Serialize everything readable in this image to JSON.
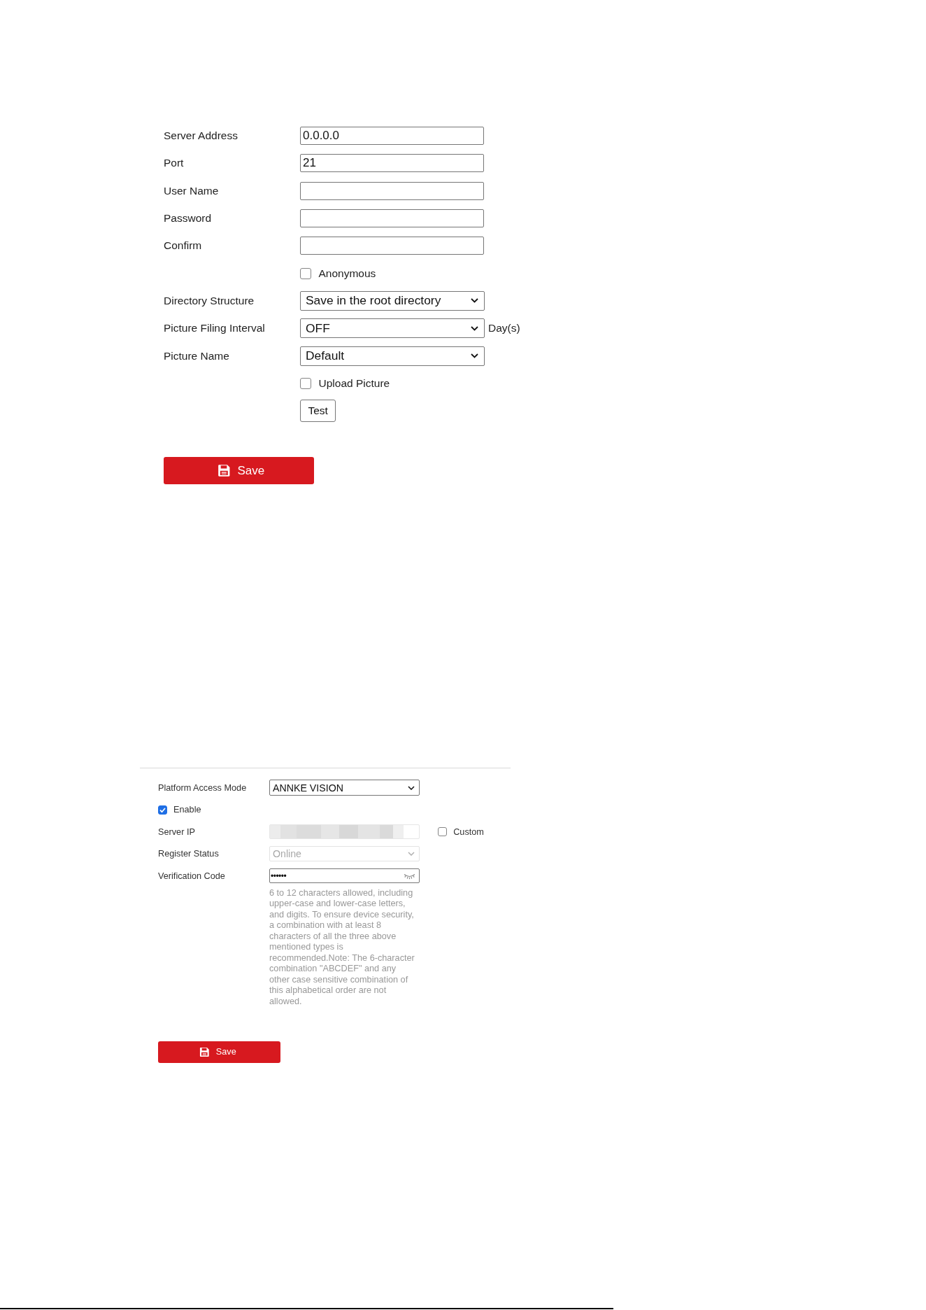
{
  "ftp_form": {
    "fields": [
      {
        "kind": "text",
        "label": "Server Address",
        "value": "0.0.0.0"
      },
      {
        "kind": "text",
        "label": "Port",
        "value": "21"
      },
      {
        "kind": "text",
        "label": "User Name"
      },
      {
        "kind": "text",
        "label": "Password"
      },
      {
        "kind": "text",
        "label": "Confirm"
      },
      {
        "kind": "checkbox",
        "label": "Anonymous",
        "checked": false
      },
      {
        "kind": "select",
        "label": "Directory Structure",
        "value": "Save in the root directory"
      },
      {
        "kind": "select",
        "label": "Picture Filing Interval",
        "value": "OFF",
        "unit": "Day(s)"
      },
      {
        "kind": "select",
        "label": "Picture Name",
        "value": "Default"
      },
      {
        "kind": "checkbox",
        "label": "Upload Picture",
        "checked": false
      },
      {
        "kind": "button",
        "label": "Test"
      }
    ],
    "save_button": "Save"
  },
  "platform_form": {
    "fields": [
      {
        "kind": "select",
        "label": "Platform Access Mode",
        "value": "ANNKE VISION",
        "disabled": false
      },
      {
        "kind": "checkbox",
        "label": "Enable",
        "checked": true,
        "disabled": false
      },
      {
        "kind": "text",
        "label": "Server IP",
        "disabled": true,
        "value_blurred": true,
        "option": {
          "label": "Custom",
          "checked": false
        }
      },
      {
        "kind": "select",
        "label": "Register Status",
        "value": "Online",
        "disabled": true
      },
      {
        "kind": "password",
        "label": "Verification Code",
        "value": "••••••",
        "disabled": false,
        "hint": "6 to 12 characters allowed, including upper-case and lower-case letters, and digits. To ensure device security, a combination with at least 8 characters of all the three above mentioned types is recommended.Note: The 6-character combination \"ABCDEF\" and any other case sensitive combination of this alphabetical order are not allowed."
      }
    ],
    "save_button": "Save"
  }
}
